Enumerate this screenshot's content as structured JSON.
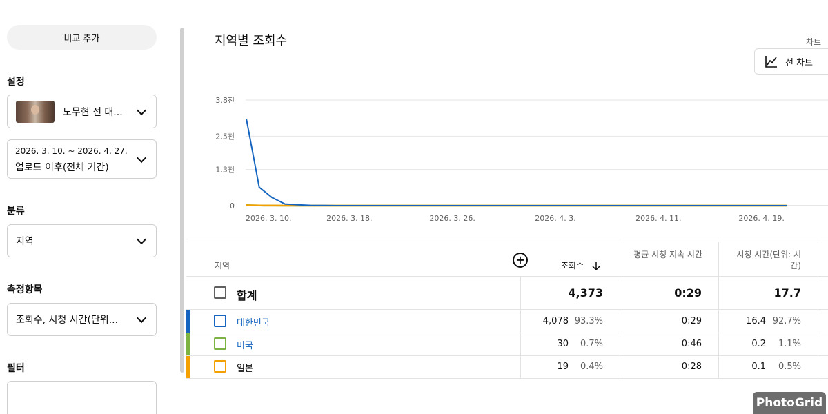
{
  "sidebar": {
    "compare_button": "비교 추가",
    "settings_label": "설정",
    "video_select": "노무현 전 대...",
    "date_range": "2026. 3. 10. ~ 2026. 4. 27.",
    "date_period": "업로드 이후(전체 기간)",
    "category_label": "분류",
    "category_value": "지역",
    "metrics_label": "측정항목",
    "metrics_value": "조회수, 시청 시간(단위...",
    "filter_label": "필터"
  },
  "main": {
    "title": "지역별 조회수",
    "chart_type_label": "차트",
    "chart_type_button": "선 차트",
    "chart_type_icon": "line-chart-icon"
  },
  "chart_data": {
    "type": "line",
    "x_tick_labels": [
      "2026. 3. 10.",
      "2026. 3. 18.",
      "2026. 3. 26.",
      "2026. 4. 3.",
      "2026. 4. 11.",
      "2026. 4. 19."
    ],
    "y_tick_labels": [
      "3.8천",
      "2.5천",
      "1.3천",
      "0"
    ],
    "y_ticks": [
      3800,
      2500,
      1300,
      0
    ],
    "ylim": [
      0,
      3800
    ],
    "x": [
      "2026-03-10",
      "2026-03-11",
      "2026-03-12",
      "2026-03-13",
      "2026-03-14",
      "2026-03-15",
      "2026-03-16",
      "2026-03-17",
      "2026-03-18",
      "2026-03-19",
      "2026-03-20",
      "2026-03-21",
      "2026-03-22",
      "2026-03-23",
      "2026-03-24",
      "2026-03-25",
      "2026-03-26",
      "2026-03-27",
      "2026-03-28",
      "2026-03-29",
      "2026-03-30",
      "2026-03-31",
      "2026-04-01",
      "2026-04-02",
      "2026-04-03",
      "2026-04-04",
      "2026-04-05",
      "2026-04-06",
      "2026-04-07",
      "2026-04-08",
      "2026-04-09",
      "2026-04-10",
      "2026-04-11",
      "2026-04-12",
      "2026-04-13",
      "2026-04-14",
      "2026-04-15",
      "2026-04-16",
      "2026-04-17",
      "2026-04-18",
      "2026-04-19",
      "2026-04-20",
      "2026-04-21"
    ],
    "series": [
      {
        "name": "대한민국",
        "color": "#1565c0",
        "values": [
          3130,
          660,
          290,
          60,
          30,
          10,
          5,
          0,
          0,
          0,
          0,
          0,
          0,
          0,
          0,
          0,
          0,
          0,
          0,
          0,
          0,
          0,
          0,
          0,
          0,
          0,
          0,
          0,
          0,
          0,
          0,
          0,
          0,
          0,
          0,
          0,
          0,
          0,
          0,
          0,
          0,
          0,
          0
        ]
      },
      {
        "name": "미국",
        "color": "#7cb342",
        "values": [
          20,
          5,
          2,
          1,
          0,
          0,
          0,
          0,
          0,
          0,
          0,
          0,
          0,
          0,
          0,
          0,
          0,
          0,
          0,
          0,
          0,
          0,
          0,
          0,
          0,
          0,
          0,
          0,
          0,
          0,
          0,
          0,
          0,
          0,
          0,
          0,
          0,
          0,
          0,
          0,
          0,
          0,
          0
        ]
      },
      {
        "name": "일본",
        "color": "#f4a000",
        "values": [
          12,
          4,
          2,
          1,
          0,
          0,
          0,
          0,
          0,
          0,
          0,
          0,
          0,
          0,
          0,
          0,
          0,
          0,
          0,
          0,
          0,
          0,
          0,
          0,
          0,
          0,
          0,
          0,
          0,
          0,
          0,
          0,
          0,
          0,
          0,
          0,
          0,
          0,
          0,
          0,
          0,
          0,
          0
        ]
      }
    ]
  },
  "table": {
    "headers": {
      "region": "지역",
      "views": "조회수",
      "avg_duration": "평균 시청 지속 시간",
      "watch_time": "시청 시간(단위: 시간)"
    },
    "total": {
      "label": "합계",
      "views": "4,373",
      "avg_duration": "0:29",
      "watch_time": "17.7"
    },
    "rows": [
      {
        "region": "대한민국",
        "views": "4,078",
        "views_pct": "93.3%",
        "avg_duration": "0:29",
        "watch_time": "16.4",
        "watch_pct": "92.7%",
        "color": "#1565c0"
      },
      {
        "region": "미국",
        "views": "30",
        "views_pct": "0.7%",
        "avg_duration": "0:46",
        "watch_time": "0.2",
        "watch_pct": "1.1%",
        "color": "#7cb342"
      },
      {
        "region": "일본",
        "views": "19",
        "views_pct": "0.4%",
        "avg_duration": "0:28",
        "watch_time": "0.1",
        "watch_pct": "0.5%",
        "color": "#f4a000"
      }
    ]
  },
  "watermark": "PhotoGrid"
}
